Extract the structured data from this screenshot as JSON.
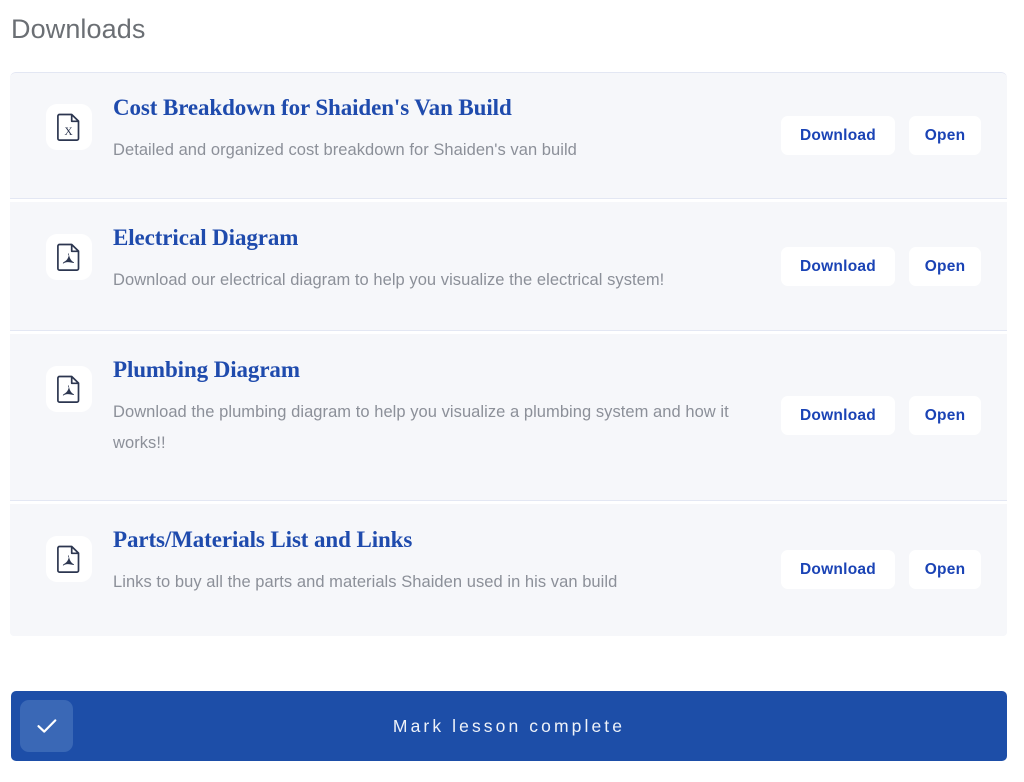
{
  "page": {
    "title": "Downloads"
  },
  "downloads": {
    "rows": [
      {
        "icon": "excel-file-icon",
        "icon_letter": "X",
        "title": "Cost Breakdown for Shaiden's Van Build",
        "description": "Detailed and organized cost breakdown for Shaiden's van build",
        "download_label": "Download",
        "open_label": "Open"
      },
      {
        "icon": "pdf-file-icon",
        "icon_letter": "A",
        "title": "Electrical Diagram",
        "description": "Download our electrical diagram to help you visualize the electrical system!",
        "download_label": "Download",
        "open_label": "Open"
      },
      {
        "icon": "pdf-file-icon",
        "icon_letter": "A",
        "title": "Plumbing Diagram",
        "description": "Download the plumbing diagram to help you visualize a plumbing system and how it works!!",
        "download_label": "Download",
        "open_label": "Open"
      },
      {
        "icon": "pdf-file-icon",
        "icon_letter": "A",
        "title": "Parts/Materials List and Links",
        "description": "Links to buy all the parts and materials Shaiden used in his van build",
        "download_label": "Download",
        "open_label": "Open"
      }
    ]
  },
  "complete_button": {
    "label": "Mark lesson complete",
    "icon": "checkmark-icon"
  },
  "colors": {
    "accent_blue": "#1d4ea8",
    "link_blue": "#1f4bad",
    "button_text_blue": "#1a43b5",
    "card_background": "#f6f7fa",
    "row_divider": "#e3e7f3",
    "title_gray": "#6b6f74",
    "description_gray": "#8c9099",
    "check_tile_blue": "#3a68b6"
  }
}
